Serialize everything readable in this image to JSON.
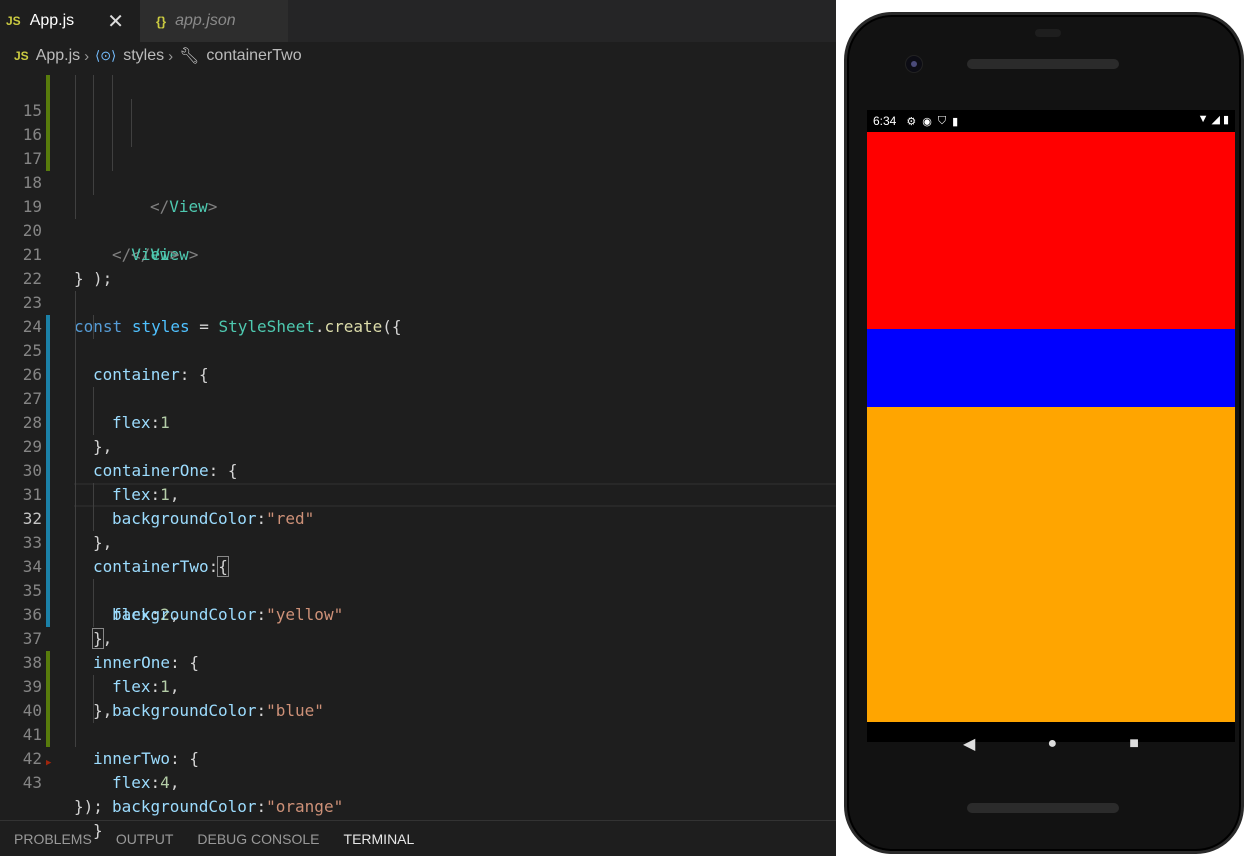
{
  "tabs": [
    {
      "badge": "JS",
      "label": "App.js",
      "close": "✕"
    },
    {
      "badge": "{}",
      "label": "app.json"
    }
  ],
  "breadcrumb": {
    "file_badge": "JS",
    "file": "App.js",
    "symbol": "styles",
    "property": "containerTwo"
  },
  "editor": {
    "lines": [
      {
        "n": "15",
        "text": ""
      },
      {
        "n": "16",
        "text": "</View>"
      },
      {
        "n": "17",
        "text": ""
      },
      {
        "n": "18",
        "text": "</View>"
      },
      {
        "n": "19",
        "text": "</View>"
      },
      {
        "n": "20",
        "text": ");"
      },
      {
        "n": "21",
        "text": "}"
      },
      {
        "n": "22",
        "text": ""
      },
      {
        "n": "23",
        "text": "const styles = StyleSheet.create({"
      },
      {
        "n": "24",
        "text": "container: {"
      },
      {
        "n": "25",
        "text": "flex:1"
      },
      {
        "n": "26",
        "text": "},"
      },
      {
        "n": "27",
        "text": "containerOne: {"
      },
      {
        "n": "28",
        "text": "flex:1,"
      },
      {
        "n": "29",
        "text": "backgroundColor:\"red\""
      },
      {
        "n": "30",
        "text": "},"
      },
      {
        "n": "31",
        "text": "containerTwo:{"
      },
      {
        "n": "32",
        "text": "flex:2,"
      },
      {
        "n": "33",
        "text": "backgroundColor:\"yellow\""
      },
      {
        "n": "34",
        "text": "},"
      },
      {
        "n": "35",
        "text": "innerOne: {"
      },
      {
        "n": "36",
        "text": "flex:1,"
      },
      {
        "n": "37",
        "text": "backgroundColor:\"blue\""
      },
      {
        "n": "38",
        "text": "},"
      },
      {
        "n": "39",
        "text": "innerTwo: {"
      },
      {
        "n": "40",
        "text": "flex:4,"
      },
      {
        "n": "41",
        "text": "backgroundColor:\"orange\""
      },
      {
        "n": "42",
        "text": "}"
      },
      {
        "n": "43",
        "text": "});"
      }
    ]
  },
  "panel": {
    "tabs": [
      "PROBLEMS",
      "OUTPUT",
      "DEBUG CONSOLE",
      "TERMINAL"
    ],
    "active": "TERMINAL"
  },
  "phone": {
    "time": "6:34",
    "status_icons": [
      "gear-icon",
      "app-icon",
      "shield-icon",
      "sd-card-icon"
    ],
    "right_icons": [
      "wifi-icon",
      "signal-icon",
      "battery-icon"
    ],
    "colors": {
      "container_one": "#ff0000",
      "inner_one": "#0000ff",
      "inner_two": "#ffa500"
    },
    "nav": [
      "back-icon",
      "home-icon",
      "recents-icon"
    ]
  }
}
